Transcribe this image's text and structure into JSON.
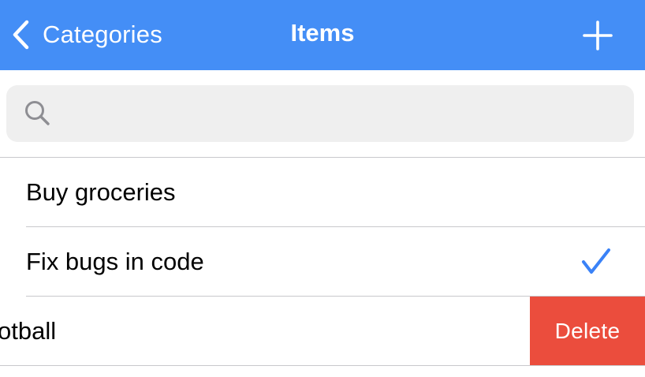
{
  "navbar": {
    "back_label": "Categories",
    "title": "Items",
    "add_icon": "plus-icon",
    "background_color": "#448ef6"
  },
  "search": {
    "icon": "search-icon",
    "value": "",
    "placeholder": ""
  },
  "items": [
    {
      "title": "Buy groceries",
      "done": false
    },
    {
      "title": "Fix bugs in code",
      "done": true
    },
    {
      "title": "otball",
      "done": false,
      "swiped": true
    }
  ],
  "swipe_action": {
    "label": "Delete",
    "color": "#eb4d3d"
  },
  "colors": {
    "accent": "#448ef6",
    "checkmark": "#3a82f7",
    "separator": "#c8c8cc"
  }
}
